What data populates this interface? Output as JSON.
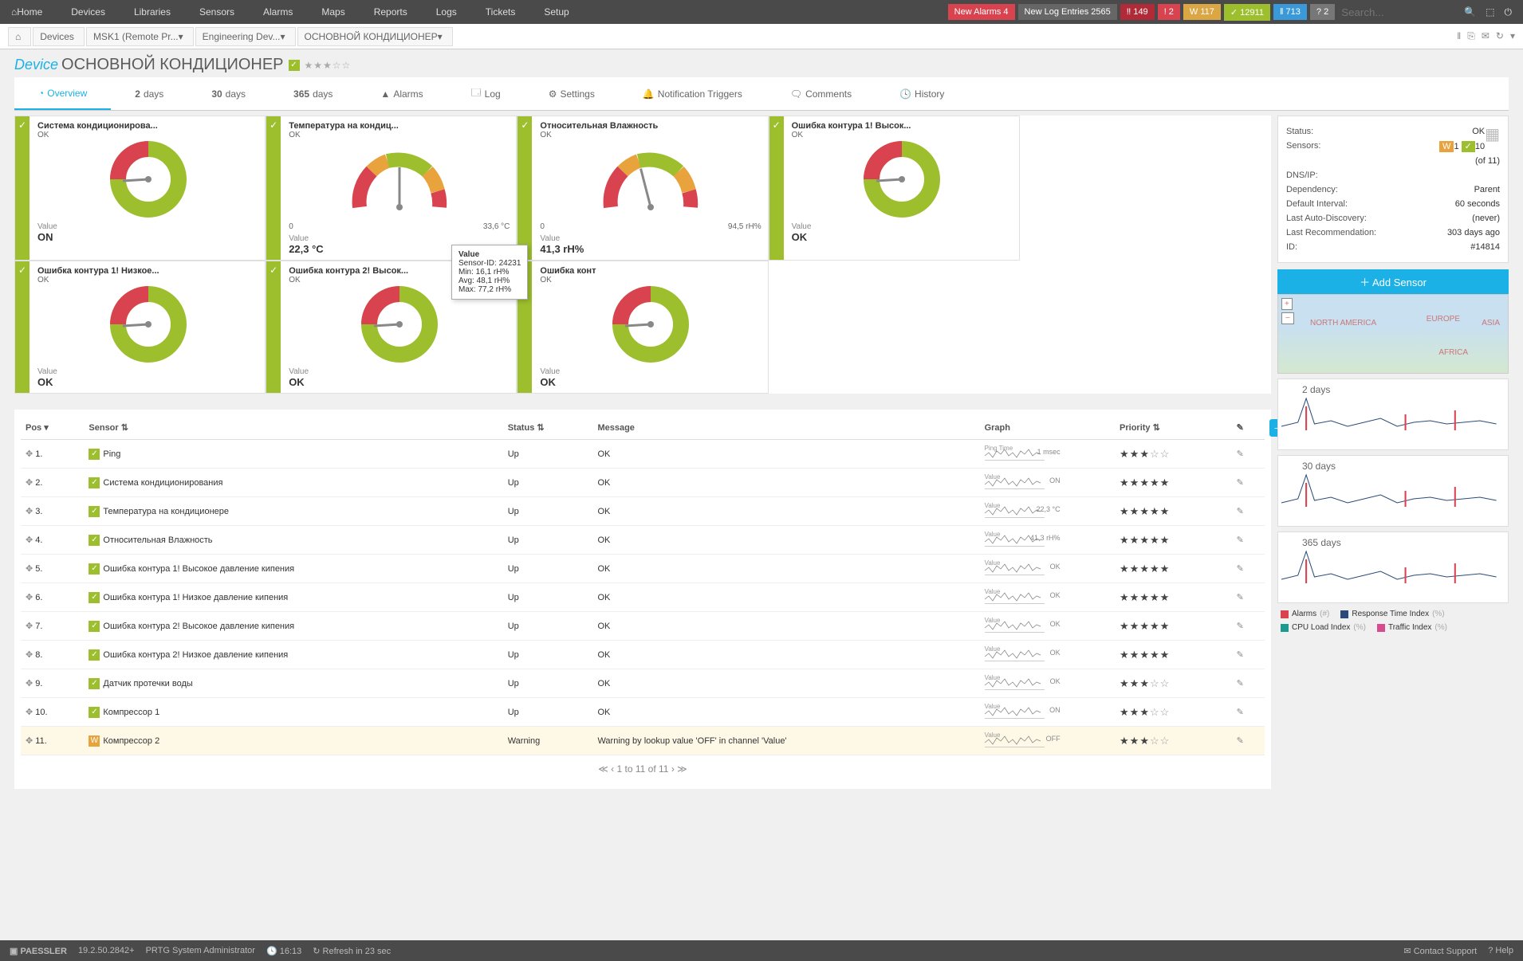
{
  "topnav": {
    "home": "Home",
    "items": [
      "Devices",
      "Libraries",
      "Sensors",
      "Alarms",
      "Maps",
      "Reports",
      "Logs",
      "Tickets",
      "Setup"
    ],
    "new_alarms": "New Alarms  4",
    "new_log": "New Log Entries  2565",
    "badges": [
      {
        "cls": "redsolid",
        "txt": "‼ 149"
      },
      {
        "cls": "red",
        "txt": "! 2"
      },
      {
        "cls": "lightorange",
        "txt": "W 117"
      },
      {
        "cls": "green",
        "txt": "✓ 12911"
      },
      {
        "cls": "blue",
        "txt": "‖ 713"
      },
      {
        "cls": "gray",
        "txt": "? 2"
      }
    ],
    "search_ph": "Search..."
  },
  "breadcrumb": [
    "Devices",
    "MSK1 (Remote Pr...",
    "Engineering Dev...",
    "ОСНОВНОЙ КОНДИЦИОНЕР"
  ],
  "title": {
    "prefix": "Device",
    "name": "ОСНОВНОЙ КОНДИЦИОНЕР",
    "stars": "★★★☆☆"
  },
  "tabs": [
    {
      "icon": "◔",
      "label": "Overview",
      "active": true
    },
    {
      "icon": "",
      "label": "2 days"
    },
    {
      "icon": "",
      "label": "30 days"
    },
    {
      "icon": "",
      "label": "365 days"
    },
    {
      "icon": "▲",
      "label": "Alarms"
    },
    {
      "icon": "🗔",
      "label": "Log"
    },
    {
      "icon": "⚙",
      "label": "Settings"
    },
    {
      "icon": "🔔",
      "label": "Notification Triggers"
    },
    {
      "icon": "🗨",
      "label": "Comments"
    },
    {
      "icon": "🕓",
      "label": "History"
    }
  ],
  "sensors": [
    {
      "name": "Система кондиционирова...",
      "status": "OK",
      "label": "Value",
      "value": "ON",
      "type": "donut"
    },
    {
      "name": "Температура на кондиц...",
      "status": "OK",
      "label": "Value",
      "value": "22,3 °C",
      "type": "gauge",
      "min": "0",
      "max": "33,6 °C",
      "needle": 0.5
    },
    {
      "name": "Относительная Влажность",
      "status": "OK",
      "label": "Value",
      "value": "41,3 rH%",
      "type": "gauge",
      "min": "0",
      "max": "94,5 rH%",
      "needle": 0.42
    },
    {
      "name": "Ошибка контура 1! Высок...",
      "status": "OK",
      "label": "Value",
      "value": "OK",
      "type": "donut"
    },
    {
      "name": "",
      "status": "",
      "label": "",
      "value": "",
      "type": "empty"
    },
    {
      "name": "Ошибка контура 1! Низкое...",
      "status": "OK",
      "label": "Value",
      "value": "OK",
      "type": "donut"
    },
    {
      "name": "Ошибка контура 2! Высок...",
      "status": "OK",
      "label": "Value",
      "value": "OK",
      "type": "donut"
    },
    {
      "name": "Ошибка конт",
      "status": "OK",
      "label": "Value",
      "value": "OK",
      "type": "donut"
    }
  ],
  "tooltip": {
    "title": "Value",
    "id": "Sensor-ID: 24231",
    "min": "Min: 16,1 rH%",
    "avg": "Avg: 48,1 rH%",
    "max": "Max: 77,2 rH%"
  },
  "info": {
    "rows": [
      {
        "l": "Status:",
        "v": "OK"
      },
      {
        "l": "Sensors:",
        "v": "W1 ✓10"
      },
      {
        "l": "",
        "v": "(of 11)"
      },
      {
        "l": "DNS/IP:",
        "v": ""
      },
      {
        "l": "Dependency:",
        "v": "Parent"
      },
      {
        "l": "Default Interval:",
        "v": "60 seconds"
      },
      {
        "l": "Last Auto-Discovery:",
        "v": "(never)"
      },
      {
        "l": "Last Recommendation:",
        "v": "303 days ago"
      },
      {
        "l": "ID:",
        "v": "#14814"
      }
    ],
    "add_sensor": "Add Sensor"
  },
  "mini_charts": [
    "2 days",
    "30 days",
    "365 days"
  ],
  "legend": [
    {
      "c": "#d9434f",
      "l": "Alarms",
      "u": "(#)"
    },
    {
      "c": "#2b4a7a",
      "l": "Response Time Index",
      "u": "(%)"
    },
    {
      "c": "#1d9a8f",
      "l": "CPU Load Index",
      "u": "(%)"
    },
    {
      "c": "#d94a8f",
      "l": "Traffic Index",
      "u": "(%)"
    }
  ],
  "table": {
    "headers": {
      "pos": "Pos ▾",
      "sensor": "Sensor",
      "status": "Status",
      "message": "Message",
      "graph": "Graph",
      "priority": "Priority"
    },
    "rows": [
      {
        "pos": "1.",
        "sensor": "Ping",
        "status": "Up",
        "message": "OK",
        "v": "1 msec",
        "vlabel": "Ping Time",
        "stars": 3,
        "st": "up"
      },
      {
        "pos": "2.",
        "sensor": "Система кондиционирования",
        "status": "Up",
        "message": "OK",
        "v": "ON",
        "vlabel": "Value",
        "stars": 5,
        "st": "up"
      },
      {
        "pos": "3.",
        "sensor": "Температура на кондиционере",
        "status": "Up",
        "message": "OK",
        "v": "22,3 °C",
        "vlabel": "Value",
        "stars": 5,
        "st": "up"
      },
      {
        "pos": "4.",
        "sensor": "Относительная Влажность",
        "status": "Up",
        "message": "OK",
        "v": "41,3 rH%",
        "vlabel": "Value",
        "stars": 5,
        "st": "up"
      },
      {
        "pos": "5.",
        "sensor": "Ошибка контура 1! Высокое давление кипения",
        "status": "Up",
        "message": "OK",
        "v": "OK",
        "vlabel": "Value",
        "stars": 5,
        "st": "up"
      },
      {
        "pos": "6.",
        "sensor": "Ошибка контура 1! Низкое давление кипения",
        "status": "Up",
        "message": "OK",
        "v": "OK",
        "vlabel": "Value",
        "stars": 5,
        "st": "up"
      },
      {
        "pos": "7.",
        "sensor": "Ошибка контура 2! Высокое давление кипения",
        "status": "Up",
        "message": "OK",
        "v": "OK",
        "vlabel": "Value",
        "stars": 5,
        "st": "up"
      },
      {
        "pos": "8.",
        "sensor": "Ошибка контура 2! Низкое давление кипения",
        "status": "Up",
        "message": "OK",
        "v": "OK",
        "vlabel": "Value",
        "stars": 5,
        "st": "up"
      },
      {
        "pos": "9.",
        "sensor": "Датчик протечки воды",
        "status": "Up",
        "message": "OK",
        "v": "OK",
        "vlabel": "Value",
        "stars": 3,
        "st": "up"
      },
      {
        "pos": "10.",
        "sensor": "Компрессор 1",
        "status": "Up",
        "message": "OK",
        "v": "ON",
        "vlabel": "Value",
        "stars": 3,
        "st": "up"
      },
      {
        "pos": "11.",
        "sensor": "Компрессор 2",
        "status": "Warning",
        "message": "Warning by lookup value 'OFF' in channel 'Value'",
        "v": "OFF",
        "vlabel": "Value",
        "stars": 3,
        "st": "warn"
      }
    ],
    "pager": "1 to 11 of 11"
  },
  "footer": {
    "brand": "PAESSLER",
    "ver": "19.2.50.2842+",
    "admin": "PRTG System Administrator",
    "time": "16:13",
    "refresh": "Refresh in 23 sec",
    "contact": "Contact Support",
    "help": "Help"
  }
}
